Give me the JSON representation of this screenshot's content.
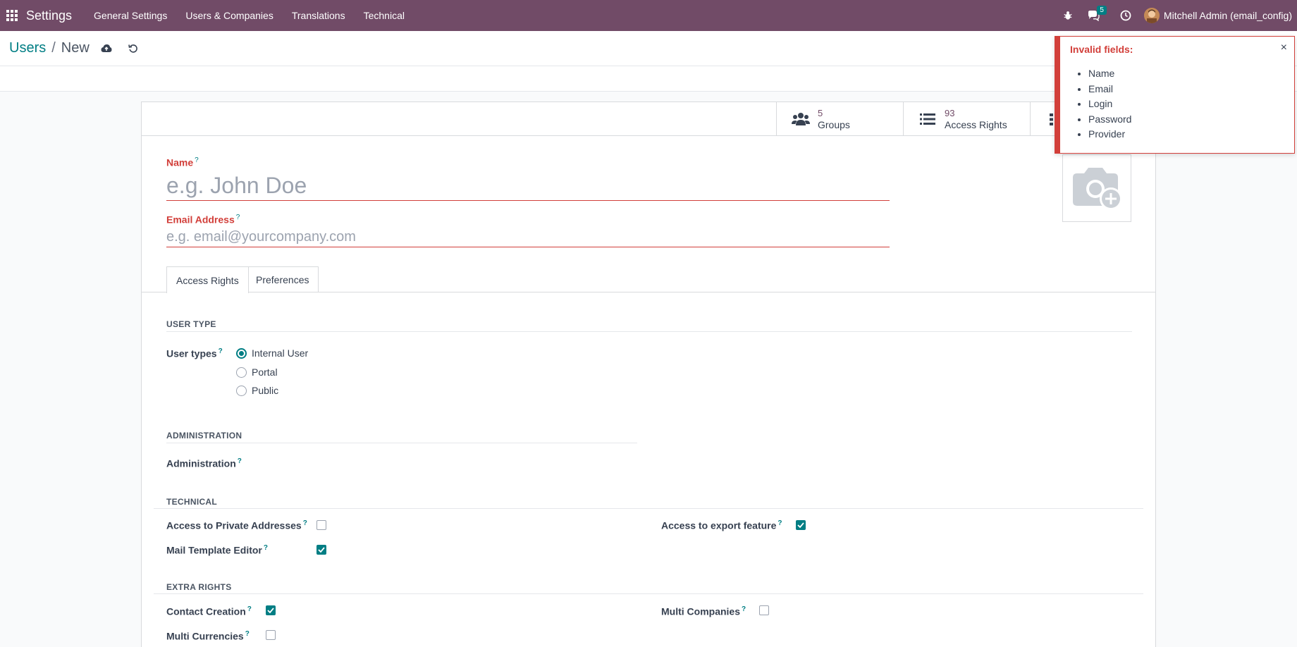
{
  "navbar": {
    "app_title": "Settings",
    "menu": [
      "General Settings",
      "Users & Companies",
      "Translations",
      "Technical"
    ],
    "messages_badge": "5",
    "user_name": "Mitchell Admin (email_config)"
  },
  "breadcrumb": {
    "parent": "Users",
    "separator": "/",
    "current": "New"
  },
  "stat_buttons": [
    {
      "value": "5",
      "label": "Groups",
      "icon": "users-icon"
    },
    {
      "value": "93",
      "label": "Access Rights",
      "icon": "list-icon"
    }
  ],
  "form": {
    "name_label": "Name",
    "name_placeholder": "e.g. John Doe",
    "email_label": "Email Address",
    "email_placeholder": "e.g. email@yourcompany.com",
    "help_mark": "?"
  },
  "tabs": [
    {
      "label": "Access Rights",
      "active": true
    },
    {
      "label": "Preferences",
      "active": false
    }
  ],
  "user_type": {
    "section": "USER TYPE",
    "label": "User types",
    "options": [
      {
        "label": "Internal User",
        "checked": true
      },
      {
        "label": "Portal",
        "checked": false
      },
      {
        "label": "Public",
        "checked": false
      }
    ]
  },
  "administration": {
    "section": "ADMINISTRATION",
    "label": "Administration"
  },
  "technical": {
    "section": "TECHNICAL",
    "private_addresses": {
      "label": "Access to Private Addresses",
      "checked": false
    },
    "mail_template": {
      "label": "Mail Template Editor",
      "checked": true
    },
    "export_feature": {
      "label": "Access to export feature",
      "checked": true
    }
  },
  "extra_rights": {
    "section": "EXTRA RIGHTS",
    "contact_creation": {
      "label": "Contact Creation",
      "checked": true
    },
    "multi_currencies": {
      "label": "Multi Currencies",
      "checked": false
    },
    "multi_companies": {
      "label": "Multi Companies",
      "checked": false
    }
  },
  "notification": {
    "title": "Invalid fields:",
    "close": "×",
    "items": [
      "Name",
      "Email",
      "Login",
      "Password",
      "Provider"
    ]
  },
  "colors": {
    "navbar": "#714b67",
    "accent": "#017e84",
    "danger": "#d23f3a"
  }
}
